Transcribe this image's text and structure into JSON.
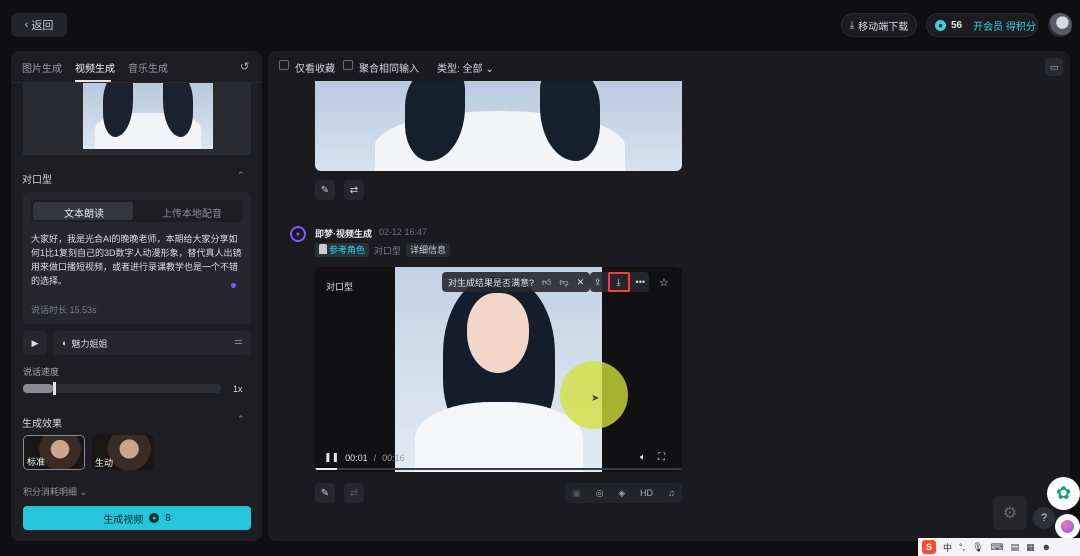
{
  "topbar": {
    "back_label": "返回",
    "mobile_download_label": "移动端下载",
    "points": "56",
    "member_label": "开会员 得积分"
  },
  "left": {
    "tabs": [
      "图片生成",
      "视频生成",
      "音乐生成"
    ],
    "active_tab": "视频生成",
    "lip_sync_title": "对口型",
    "script_modes": [
      "文本朗读",
      "上传本地配音"
    ],
    "script_text": "大家好，我是光合AI的晚晚老师，本期给大家分享如何1比1复刻自己的3D数字人动漫形象，替代真人出镜用来做口播短视频，或者进行录课教学也是一个不错的选择。",
    "duration_text": "说话时长 15.53s",
    "voice_name": "魅力姐姐",
    "speed_label": "说话速度",
    "speed_value": "1x",
    "speed_level": 0.15,
    "effect_title": "生成效果",
    "effects": [
      "标准",
      "生动"
    ],
    "points_detail": "积分消耗明细",
    "generate_label": "生成视频",
    "generate_cost": "8"
  },
  "main": {
    "filters": [
      "仅看收藏",
      "聚合相同输入"
    ],
    "type_filter": "类型: 全部",
    "gen_name": "即梦·视频生成",
    "gen_time": "02-12  16:47",
    "tags": {
      "reference": "参考角色",
      "lip": "对口型",
      "detail": "详细信息"
    },
    "video_label": "对口型",
    "survey_question": "对生成结果是否满意?",
    "time_current": "00:01",
    "time_sep": "/",
    "time_total": "00:16",
    "progress": 0.06,
    "hd_label": "HD"
  },
  "taskbar": {
    "ime_items": [
      "中",
      "°,"
    ]
  }
}
